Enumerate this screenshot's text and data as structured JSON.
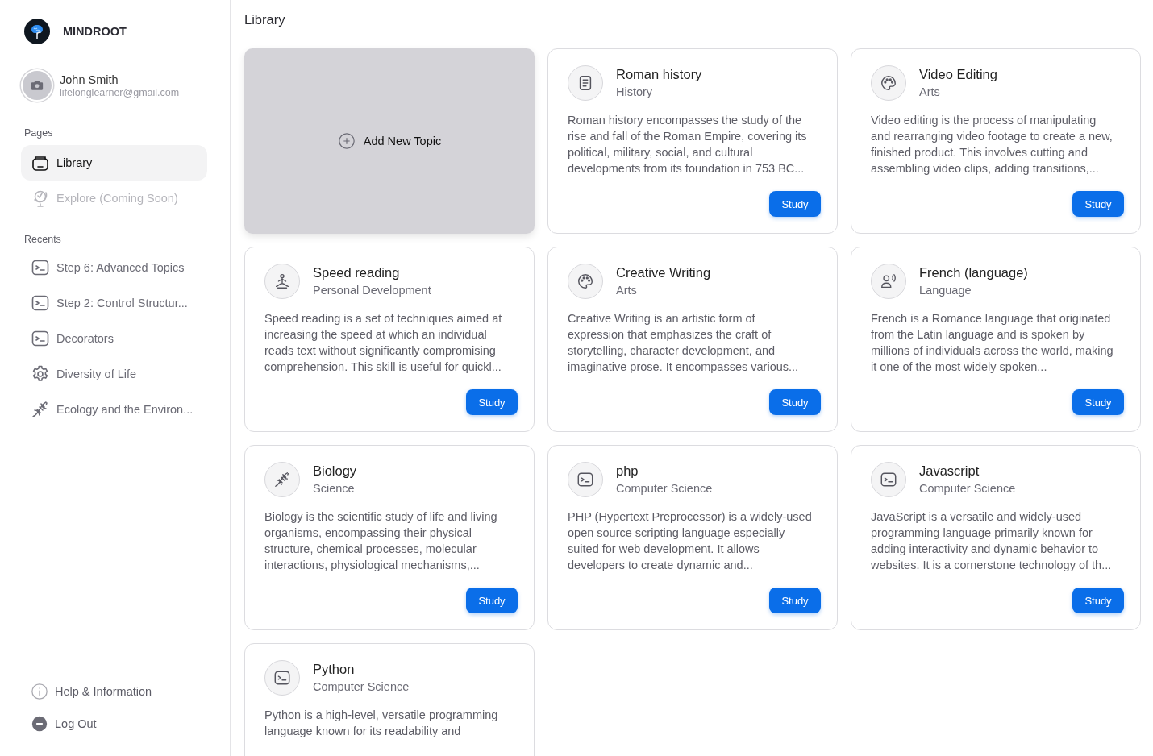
{
  "brand": {
    "name": "MINDROOT"
  },
  "user": {
    "name": "John Smith",
    "email": "lifelonglearner@gmail.com"
  },
  "sidebar": {
    "pages_heading": "Pages",
    "pages": [
      {
        "label": "Library",
        "kind": "library",
        "selected": true,
        "disabled": false
      },
      {
        "label": "Explore (Coming Soon)",
        "kind": "globe",
        "selected": false,
        "disabled": true
      }
    ],
    "recents_heading": "Recents",
    "recents": [
      {
        "label": "Step 6: Advanced Topics",
        "kind": "terminal"
      },
      {
        "label": "Step 2: Control Structur...",
        "kind": "terminal"
      },
      {
        "label": "Decorators",
        "kind": "terminal"
      },
      {
        "label": "Diversity of Life",
        "kind": "gear"
      },
      {
        "label": "Ecology and the Environ...",
        "kind": "dna"
      }
    ],
    "footer": [
      {
        "label": "Help & Information",
        "kind": "info"
      },
      {
        "label": "Log Out",
        "kind": "logout"
      }
    ]
  },
  "page_title": "Library",
  "add_card": {
    "label": "Add New Topic"
  },
  "topics": [
    {
      "title": "Roman history",
      "category": "History",
      "kind": "notebook",
      "description": "Roman history encompasses the study of the rise and fall of the Roman Empire, covering its political, military, social, and cultural developments from its foundation in 753 BC...",
      "button": "Study"
    },
    {
      "title": "Video Editing",
      "category": "Arts",
      "kind": "palette",
      "description": "Video editing is the process of manipulating and rearranging video footage to create a new, finished product. This involves cutting and assembling video clips, adding transitions,...",
      "button": "Study"
    },
    {
      "title": "Speed reading",
      "category": "Personal Development",
      "kind": "person",
      "description": "Speed reading is a set of techniques aimed at increasing the speed at which an individual reads text without significantly compromising comprehension. This skill is useful for quickl...",
      "button": "Study"
    },
    {
      "title": "Creative Writing",
      "category": "Arts",
      "kind": "palette",
      "description": "Creative Writing is an artistic form of expression that emphasizes the craft of storytelling, character development, and imaginative prose. It encompasses various...",
      "button": "Study"
    },
    {
      "title": "French (language)",
      "category": "Language",
      "kind": "speaker",
      "description": "French is a Romance language that originated from the Latin language and is spoken by millions of individuals across the world, making it one of the most widely spoken...",
      "button": "Study"
    },
    {
      "title": "Biology",
      "category": "Science",
      "kind": "dna",
      "description": "Biology is the scientific study of life and living organisms, encompassing their physical structure, chemical processes, molecular interactions, physiological mechanisms,...",
      "button": "Study"
    },
    {
      "title": "php",
      "category": "Computer Science",
      "kind": "terminal",
      "description": "PHP (Hypertext Preprocessor) is a widely-used open source scripting language especially suited for web development. It allows developers to create dynamic and...",
      "button": "Study"
    },
    {
      "title": "Javascript",
      "category": "Computer Science",
      "kind": "terminal",
      "description": "JavaScript is a versatile and widely-used programming language primarily known for adding interactivity and dynamic behavior to websites. It is a cornerstone technology of th...",
      "button": "Study"
    },
    {
      "title": "Python",
      "category": "Computer Science",
      "kind": "terminal",
      "description": "Python is a high-level, versatile programming language known for its readability and"
    }
  ]
}
